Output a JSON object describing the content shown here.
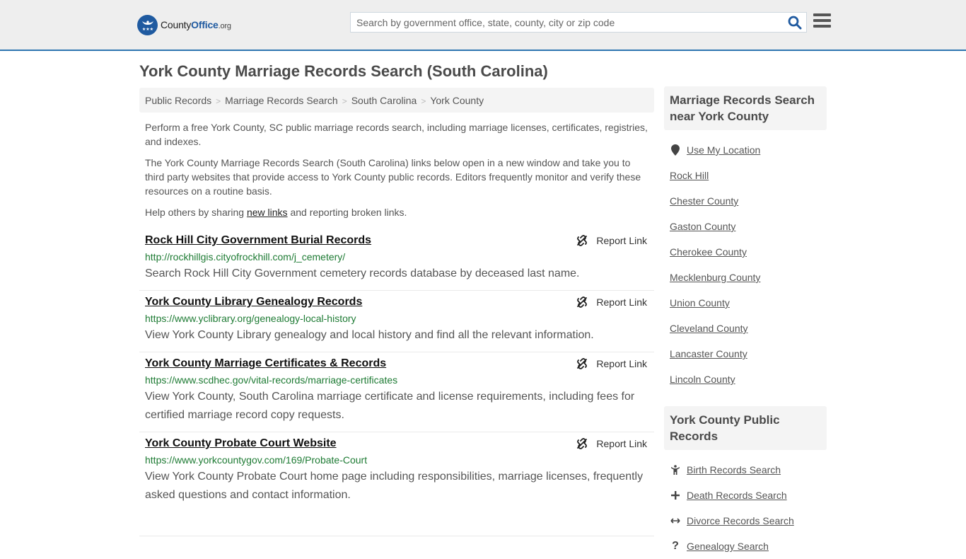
{
  "header": {
    "logo": {
      "county": "County",
      "office": "Office",
      "org": ".org"
    },
    "search": {
      "placeholder": "Search by government office, state, county, city or zip code",
      "value": ""
    },
    "colors": {
      "brand": "#1f5aa0",
      "accent_border": "#2e76b0"
    }
  },
  "page": {
    "title": "York County Marriage Records Search (South Carolina)"
  },
  "breadcrumb": [
    {
      "label": "Public Records"
    },
    {
      "label": "Marriage Records Search"
    },
    {
      "label": "South Carolina"
    },
    {
      "label": "York County"
    }
  ],
  "intro": {
    "p1": "Perform a free York County, SC public marriage records search, including marriage licenses, certificates, registries, and indexes.",
    "p2": "The York County Marriage Records Search (South Carolina) links below open in a new window and take you to third party websites that provide access to York County public records. Editors frequently monitor and verify these resources on a routine basis.",
    "p3_before": "Help others by sharing ",
    "p3_link": "new links",
    "p3_after": " and reporting broken links."
  },
  "results": [
    {
      "title": "Rock Hill City Government Burial Records",
      "url": "http://rockhillgis.cityofrockhill.com/j_cemetery/",
      "description": "Search Rock Hill City Government cemetery records database by deceased last name.",
      "report_label": "Report Link"
    },
    {
      "title": "York County Library Genealogy Records",
      "url": "https://www.yclibrary.org/genealogy-local-history",
      "description": "View York County Library genealogy and local history and find all the relevant information.",
      "report_label": "Report Link"
    },
    {
      "title": "York County Marriage Certificates & Records",
      "url": "https://www.scdhec.gov/vital-records/marriage-certificates",
      "description": "View York County, South Carolina marriage certificate and license requirements, including fees for certified marriage record copy requests.",
      "report_label": "Report Link"
    },
    {
      "title": "York County Probate Court Website",
      "url": "https://www.yorkcountygov.com/169/Probate-Court",
      "description": "View York County Probate Court home page including responsibilities, marriage licenses, frequently asked questions and contact information.",
      "report_label": "Report Link"
    }
  ],
  "sidebar": {
    "nearby": {
      "heading": "Marriage Records Search near York County",
      "use_location": {
        "label": "Use My Location",
        "icon": "map-marker-icon"
      },
      "items": [
        {
          "label": "Rock Hill"
        },
        {
          "label": "Chester County"
        },
        {
          "label": "Gaston County"
        },
        {
          "label": "Cherokee County"
        },
        {
          "label": "Mecklenburg County"
        },
        {
          "label": "Union County"
        },
        {
          "label": "Cleveland County"
        },
        {
          "label": "Lancaster County"
        },
        {
          "label": "Lincoln County"
        }
      ]
    },
    "public_records": {
      "heading": "York County Public Records",
      "items": [
        {
          "label": "Birth Records Search",
          "icon": "child-icon"
        },
        {
          "label": "Death Records Search",
          "icon": "plus-icon"
        },
        {
          "label": "Divorce Records Search",
          "icon": "arrows-horizontal-icon"
        },
        {
          "label": "Genealogy Search",
          "icon": "question-icon"
        }
      ]
    }
  }
}
